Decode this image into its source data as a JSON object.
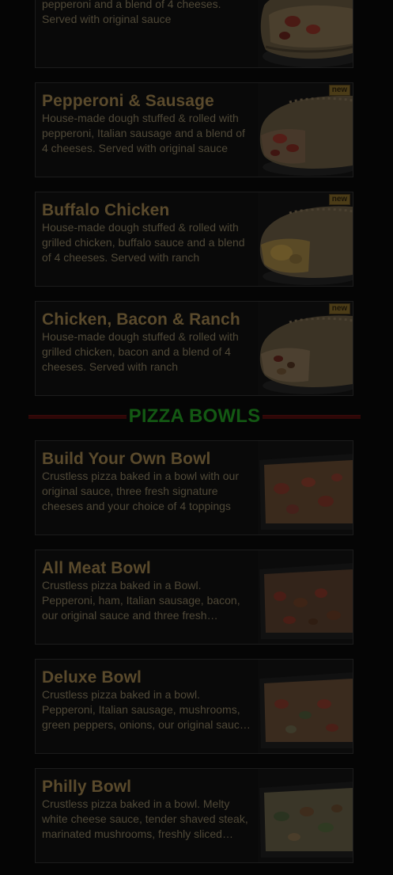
{
  "calzones": [
    {
      "title": "",
      "description": "House-made dough stuffed & rolled with pepperoni and a blend of 4 cheeses. Served with original sauce",
      "is_new": false,
      "image": "pepperoni-calzone-photo"
    },
    {
      "title": "Pepperoni & Sausage",
      "description": "House-made dough stuffed & rolled with pepperoni, Italian sausage and a blend of 4 cheeses. Served with original sauce",
      "is_new": true,
      "badge": "new",
      "image": "pepperoni-sausage-calzone-photo"
    },
    {
      "title": "Buffalo Chicken",
      "description": "House-made dough stuffed & rolled with grilled chicken, buffalo sauce and a blend of 4 cheeses. Served with ranch",
      "is_new": true,
      "badge": "new",
      "image": "buffalo-chicken-calzone-photo"
    },
    {
      "title": "Chicken, Bacon & Ranch",
      "description": "House-made dough stuffed & rolled with grilled chicken, bacon and a blend of 4 cheeses. Served with ranch",
      "is_new": true,
      "badge": "new",
      "image": "chicken-bacon-ranch-calzone-photo"
    }
  ],
  "section": {
    "title": "PIZZA BOWLS"
  },
  "bowls": [
    {
      "title": "Build Your Own Bowl",
      "description": "Crustless pizza baked in a bowl with our original sauce, three fresh signature cheeses and your choice of 4 toppings",
      "image": "build-your-own-bowl-photo"
    },
    {
      "title": "All Meat Bowl",
      "description": "Crustless pizza baked in a Bowl. Pepperoni, ham, Italian sausage, bacon, our original sauce and three fresh signature cheeses",
      "image": "all-meat-bowl-photo"
    },
    {
      "title": "Deluxe Bowl",
      "description": "Crustless pizza baked in a bowl. Pepperoni, Italian sausage, mushrooms, green peppers, onions, our original sauce and three fresh signature cheeses",
      "image": "deluxe-bowl-photo"
    },
    {
      "title": "Philly Bowl",
      "description": "Crustless pizza baked in a bowl. Melty white cheese sauce, tender shaved steak, marinated mushrooms, freshly sliced onions and green peppers",
      "image": "philly-bowl-photo"
    }
  ],
  "colors": {
    "title": "#5a4a2c",
    "description": "#4f4837",
    "section_title": "#135813",
    "section_rule": "#2e0707",
    "badge": "#4a3b17"
  }
}
